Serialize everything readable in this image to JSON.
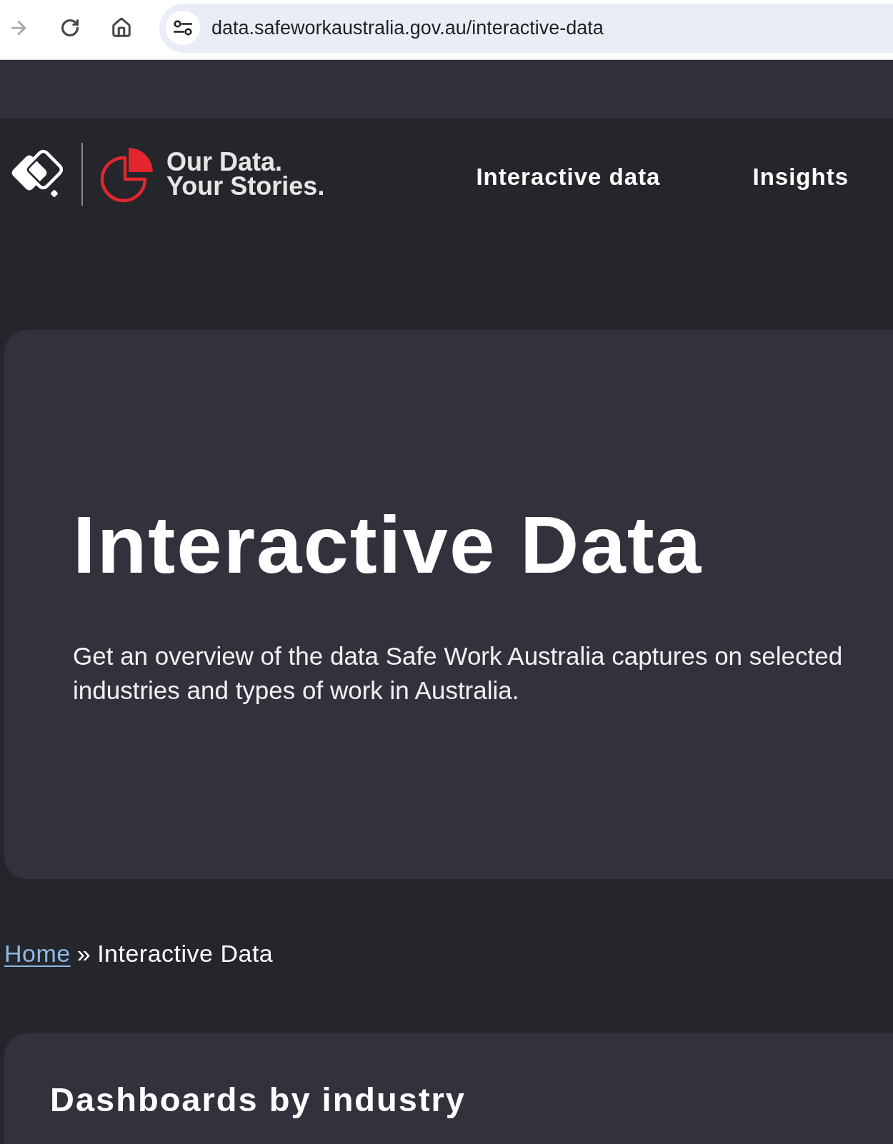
{
  "browser": {
    "buttons": [
      {
        "kind": "forward",
        "disabled": true
      },
      {
        "kind": "reload",
        "disabled": false
      },
      {
        "kind": "home",
        "disabled": false
      }
    ],
    "url": "data.safeworkaustralia.gov.au/interactive-data"
  },
  "header": {
    "logo_text": [
      "Our Data.",
      "Your Stories."
    ],
    "nav": [
      {
        "label": "Interactive data"
      },
      {
        "label": "Insights"
      }
    ]
  },
  "hero": {
    "title": "Interactive Data",
    "description": "Get an overview of the data Safe Work Australia captures on selected industries and types of work in Australia."
  },
  "breadcrumb": {
    "items": [
      {
        "label": "Home",
        "kind": "link"
      },
      {
        "label": "Interactive Data",
        "kind": "current"
      }
    ],
    "separator": "»"
  },
  "section": {
    "title": "Dashboards by industry"
  }
}
